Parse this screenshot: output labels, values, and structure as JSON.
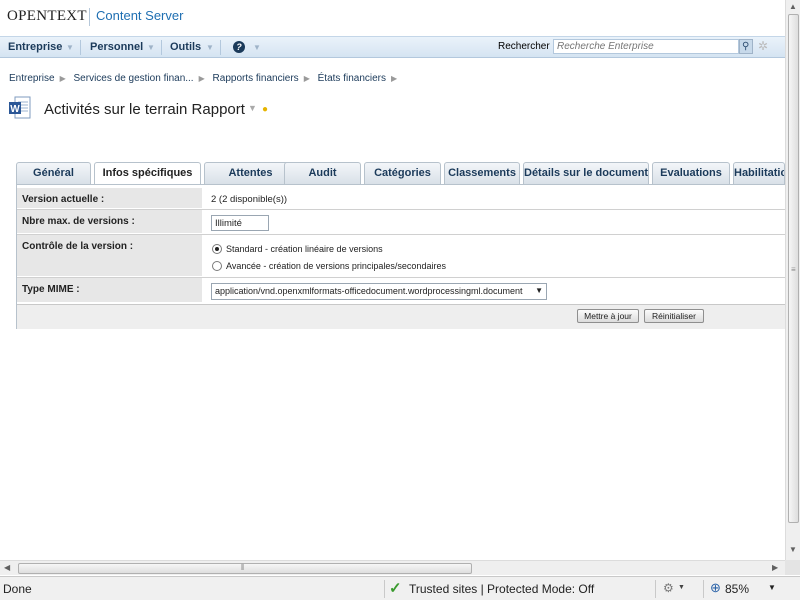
{
  "header": {
    "brand": "OPENTEXT",
    "product": "Content Server"
  },
  "nav": {
    "items": [
      {
        "label": "Entreprise"
      },
      {
        "label": "Personnel"
      },
      {
        "label": "Outils"
      }
    ],
    "help_icon": "help-icon",
    "search_label": "Rechercher",
    "search_placeholder": "Recherche Enterprise"
  },
  "breadcrumb": [
    "Entreprise",
    "Services de gestion finan...",
    "Rapports financiers",
    "États financiers"
  ],
  "page": {
    "title": "Activités sur le terrain Rapport",
    "doc_icon": "word-document-icon"
  },
  "tabs": [
    {
      "label": "Général"
    },
    {
      "label": "Infos spécifiques",
      "active": true
    },
    {
      "label": "Attentes"
    },
    {
      "label": "Audit"
    },
    {
      "label": "Catégories"
    },
    {
      "label": "Classements"
    },
    {
      "label": "Détails sur le document"
    },
    {
      "label": "Evaluations"
    },
    {
      "label": "Habilitations"
    }
  ],
  "specific_info": {
    "version_label": "Version actuelle :",
    "version_value": "2 (2 disponible(s))",
    "max_versions_label": "Nbre max. de versions :",
    "max_versions_value": "Illimité",
    "version_control_label": "Contrôle de la version :",
    "version_options": [
      {
        "label": "Standard - création linéaire de versions",
        "checked": true
      },
      {
        "label": "Avancée - création de versions principales/secondaires",
        "checked": false
      }
    ],
    "mime_label": "Type MIME :",
    "mime_value": "application/vnd.openxmlformats-officedocument.wordprocessingml.document",
    "update_button": "Mettre à jour",
    "reset_button": "Réinitialiser"
  },
  "statusbar": {
    "status": "Done",
    "zone": "Trusted sites | Protected Mode: Off",
    "zoom": "85%"
  },
  "colors": {
    "nav_bg": "#d5e4f2",
    "link": "#1b3a5a",
    "product": "#1f6fb2",
    "label_bg": "#e7e7e7",
    "check": "#3a9a2e"
  }
}
